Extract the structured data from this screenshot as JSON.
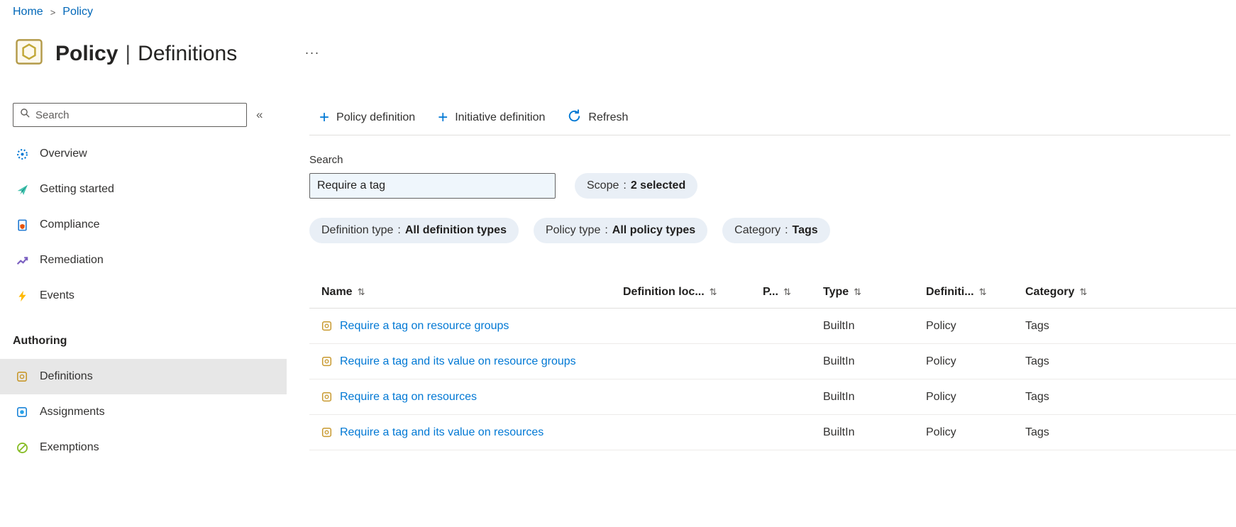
{
  "breadcrumb": {
    "items": [
      {
        "label": "Home"
      },
      {
        "label": "Policy"
      }
    ],
    "separator": ">"
  },
  "header": {
    "title_primary": "Policy",
    "title_divider": "|",
    "title_secondary": "Definitions",
    "more_button": "..."
  },
  "sidebar": {
    "search_placeholder": "Search",
    "collapse_glyph": "«",
    "items": [
      {
        "label": "Overview"
      },
      {
        "label": "Getting started"
      },
      {
        "label": "Compliance"
      },
      {
        "label": "Remediation"
      },
      {
        "label": "Events"
      }
    ],
    "section_label": "Authoring",
    "authoring_items": [
      {
        "label": "Definitions",
        "selected": true
      },
      {
        "label": "Assignments",
        "selected": false
      },
      {
        "label": "Exemptions",
        "selected": false
      }
    ]
  },
  "toolbar": {
    "plus_glyph": "+",
    "policy_definition": "Policy definition",
    "initiative_definition": "Initiative definition",
    "refresh": "Refresh"
  },
  "filters": {
    "search_label": "Search",
    "search_value": "Require a tag",
    "pills": [
      {
        "name": "Scope",
        "sep": ":",
        "value": "2 selected"
      },
      {
        "name": "Definition type",
        "sep": ":",
        "value": "All definition types"
      },
      {
        "name": "Policy type",
        "sep": ":",
        "value": "All policy types"
      },
      {
        "name": "Category",
        "sep": ":",
        "value": "Tags"
      }
    ]
  },
  "table": {
    "sort_glyph": "⇅",
    "columns": [
      {
        "label": "Name"
      },
      {
        "label": "Definition loc..."
      },
      {
        "label": "P..."
      },
      {
        "label": "Type"
      },
      {
        "label": "Definiti..."
      },
      {
        "label": "Category"
      }
    ],
    "rows": [
      {
        "name": "Require a tag on resource groups",
        "definition_location": "",
        "p": "",
        "type": "BuiltIn",
        "definition_type": "Policy",
        "category": "Tags"
      },
      {
        "name": "Require a tag and its value on resource groups",
        "definition_location": "",
        "p": "",
        "type": "BuiltIn",
        "definition_type": "Policy",
        "category": "Tags"
      },
      {
        "name": "Require a tag on resources",
        "definition_location": "",
        "p": "",
        "type": "BuiltIn",
        "definition_type": "Policy",
        "category": "Tags"
      },
      {
        "name": "Require a tag and its value on resources",
        "definition_location": "",
        "p": "",
        "type": "BuiltIn",
        "definition_type": "Policy",
        "category": "Tags"
      }
    ]
  },
  "colors": {
    "accent": "#0078d4",
    "link": "#0078d4",
    "breadcrumb_link": "#0067b8",
    "pill_background": "#e9eff6",
    "search_input_background": "#eff6fc",
    "selected_item_background": "#e7e7e7",
    "text": "#323130",
    "muted": "#605e5c",
    "policy_icon_gold": "#b49b4a"
  }
}
